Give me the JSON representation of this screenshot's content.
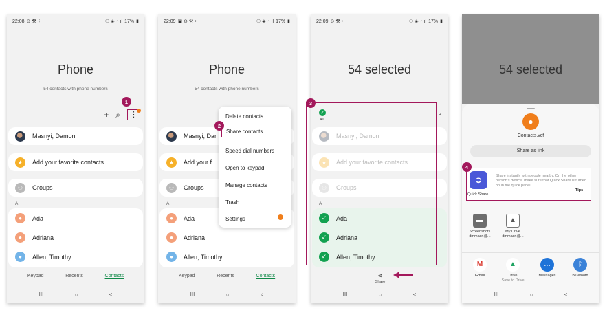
{
  "colors": {
    "accent": "#a3185b",
    "active_tab": "#108948",
    "check_green": "#12a150",
    "badge_orange": "#f07e1b"
  },
  "phones": [
    {
      "status_time": "22:08",
      "status_right": "17%",
      "title": "Phone",
      "subtitle": "54 contacts with phone numbers"
    },
    {
      "status_time": "22:09",
      "status_right": "17%",
      "title": "Phone",
      "subtitle": "54 contacts with phone numbers"
    },
    {
      "status_time": "22:09",
      "status_right": "17%",
      "title": "54 selected"
    },
    {
      "title": "54 selected"
    }
  ],
  "contacts": {
    "profile": "Masnyi, Damon",
    "favorites": "Add your favorite contacts",
    "groups": "Groups",
    "section": "A",
    "rows": [
      "Ada",
      "Adriana",
      "Allen, Timothy"
    ]
  },
  "p2_truncated": {
    "profile": "Masnyi, Dar",
    "favorites": "Add your f"
  },
  "icons": {
    "add": "plus-icon",
    "search": "search-icon",
    "more": "more-vert-icon"
  },
  "tabs": [
    "Keypad",
    "Recents",
    "Contacts"
  ],
  "navbar": [
    "III",
    "○",
    "<"
  ],
  "menu": [
    "Delete contacts",
    "Share contacts",
    "Speed dial numbers",
    "Open to keypad",
    "Manage contacts",
    "Trash",
    "Settings"
  ],
  "steps": [
    "1",
    "2",
    "3",
    "4"
  ],
  "selection": {
    "all_label": "All",
    "share_label": "Share"
  },
  "share_sheet": {
    "file_name": "Contacts.vcf",
    "share_link": "Share as link",
    "quick_share_label": "Quick Share",
    "quick_share_text": "Share instantly with people nearby. On the other person's device, make sure that Quick Share is turned on in the quick panel.",
    "tips": "Tips",
    "recent_targets": [
      {
        "line1": "Screenshots",
        "line2": "dmmasn@..."
      },
      {
        "line1": "My Drive",
        "line2": "dmmasn@..."
      }
    ],
    "apps": [
      {
        "line1": "Gmail",
        "line2": ""
      },
      {
        "line1": "Drive",
        "line2": "Save to Drive"
      },
      {
        "line1": "Messages",
        "line2": ""
      },
      {
        "line1": "Bluetooth",
        "line2": ""
      }
    ]
  }
}
